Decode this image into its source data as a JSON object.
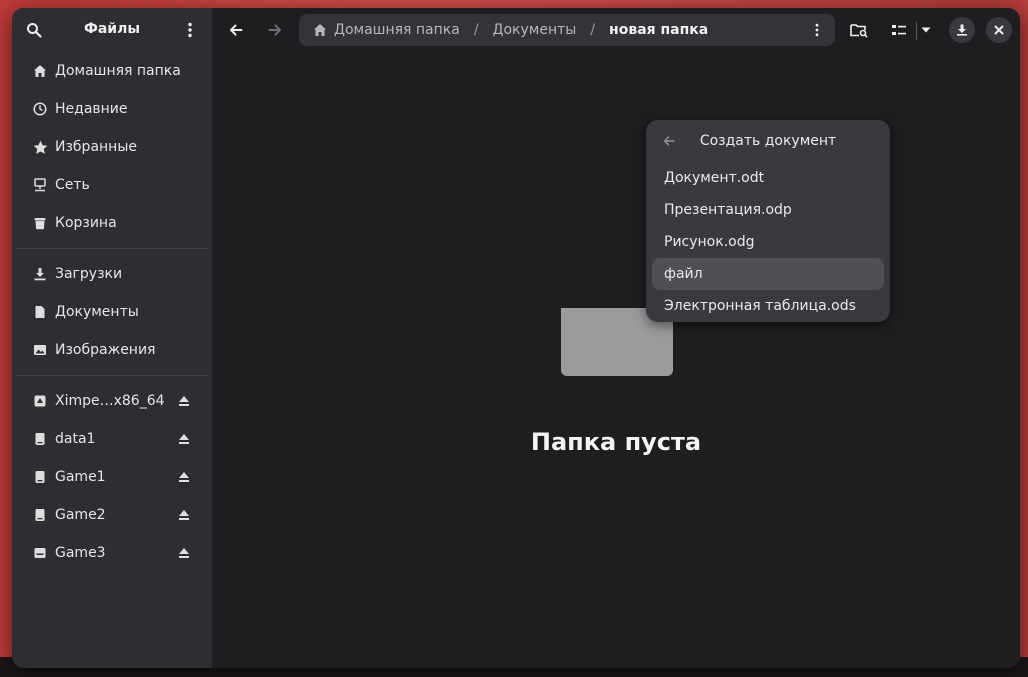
{
  "sidebar": {
    "title": "Файлы",
    "places": [
      {
        "label": "Домашняя папка",
        "icon": "home-icon"
      },
      {
        "label": "Недавние",
        "icon": "clock-icon"
      },
      {
        "label": "Избранные",
        "icon": "star-icon"
      },
      {
        "label": "Сеть",
        "icon": "network-icon"
      },
      {
        "label": "Корзина",
        "icon": "trash-icon"
      }
    ],
    "bookmarks": [
      {
        "label": "Загрузки",
        "icon": "download-icon"
      },
      {
        "label": "Документы",
        "icon": "document-icon"
      },
      {
        "label": "Изображения",
        "icon": "image-icon"
      }
    ],
    "devices": [
      {
        "label": "Ximpe…x86_64",
        "icon": "optical-drive-icon"
      },
      {
        "label": "data1",
        "icon": "drive-icon"
      },
      {
        "label": "Game1",
        "icon": "drive-icon"
      },
      {
        "label": "Game2",
        "icon": "drive-icon"
      },
      {
        "label": "Game3",
        "icon": "drive-icon"
      }
    ]
  },
  "pathbar": {
    "crumbs": [
      "Домашняя папка",
      "Документы",
      "новая папка"
    ],
    "separator": "/"
  },
  "main": {
    "empty_title": "Папка пуста"
  },
  "popover": {
    "title": "Создать документ",
    "items": [
      "Документ.odt",
      "Презентация.odp",
      "Рисунок.odg",
      "файл",
      "Электронная таблица.ods"
    ],
    "highlighted_index": 3
  },
  "colors": {
    "window_bg": "#1e1e20",
    "sidebar_bg": "#2e2e32",
    "popover_bg": "#3a3a3e",
    "highlight_bg": "#4f4f54",
    "wallpaper": "#d04848"
  }
}
